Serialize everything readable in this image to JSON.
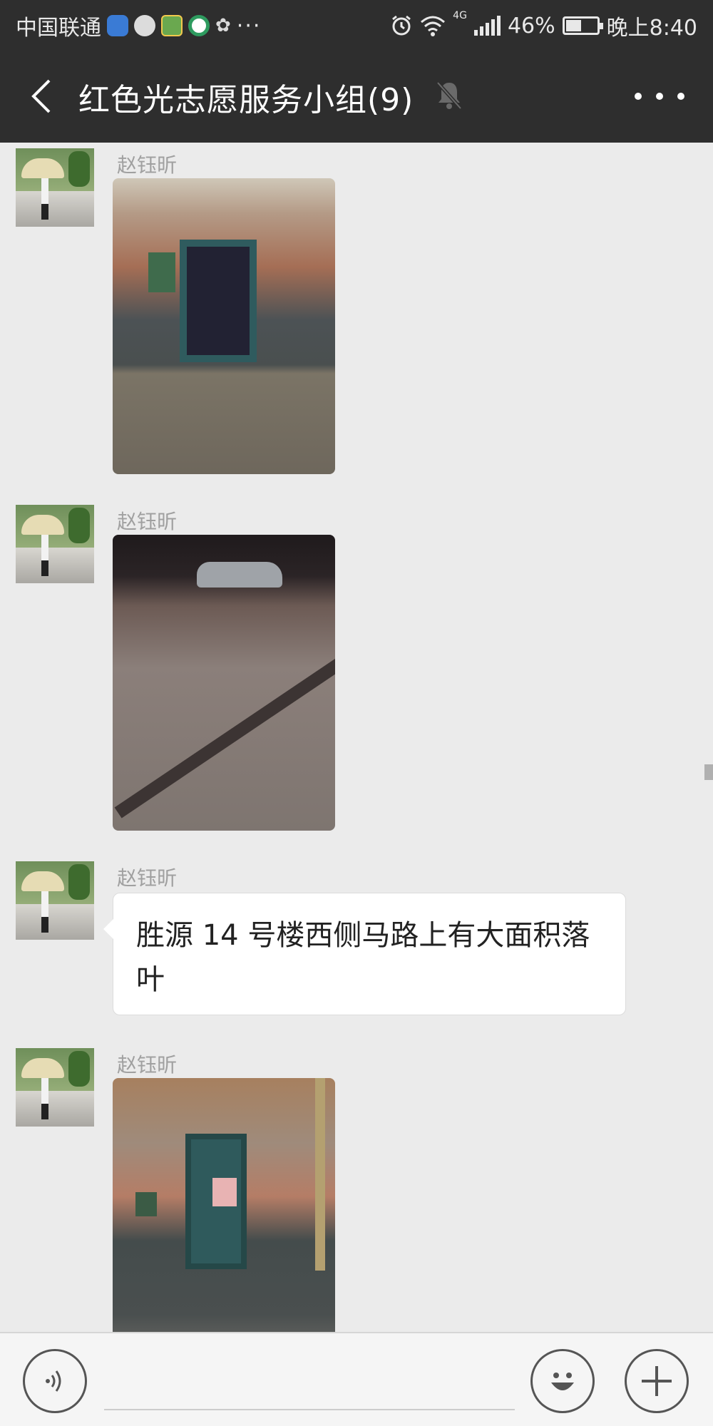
{
  "status_bar": {
    "carrier": "中国联通",
    "more_notifications": "···",
    "network_type": "4G",
    "battery_percent": "46%",
    "battery_level": 0.46,
    "time": "晚上8:40",
    "icons": [
      "shield-app-icon",
      "chat-app-icon",
      "game-app-icon",
      "news-app-icon",
      "huawei-icon",
      "alarm-icon",
      "wifi-icon",
      "signal-icon",
      "battery-icon"
    ]
  },
  "header": {
    "title": "红色光志愿服务小组(9)",
    "back_icon": "chevron-left-icon",
    "mute_icon": "bell-muted-icon",
    "more_icon": "more-dots-icon"
  },
  "messages": [
    {
      "sender": "赵钰昕",
      "type": "image",
      "image_desc": "building-doorway-photo"
    },
    {
      "sender": "赵钰昕",
      "type": "image",
      "image_desc": "leaves-on-road-photo"
    },
    {
      "sender": "赵钰昕",
      "type": "text",
      "text": "胜源 14 号楼西侧马路上有大面积落叶"
    },
    {
      "sender": "赵钰昕",
      "type": "image",
      "image_desc": "green-door-photo"
    }
  ],
  "input_bar": {
    "voice_icon": "voice-icon",
    "emoji_icon": "emoji-icon",
    "plus_icon": "plus-icon"
  },
  "colors": {
    "header_bg": "#2e2e2e",
    "chat_bg": "#ebebeb",
    "bubble_bg": "#ffffff",
    "sender_name": "#a0a0a0"
  }
}
